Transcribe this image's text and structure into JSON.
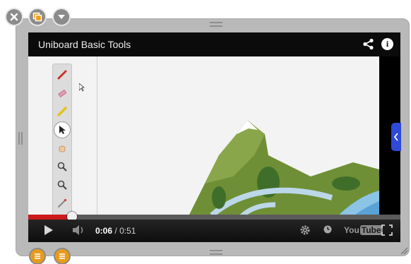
{
  "window": {
    "controls": [
      {
        "name": "close",
        "icon": "close-icon"
      },
      {
        "name": "duplicate",
        "icon": "duplicate-icon"
      },
      {
        "name": "menu",
        "icon": "chevron-down-icon"
      }
    ]
  },
  "video": {
    "title": "Uniboard Basic Tools",
    "current_time": "0:06",
    "separator": "/",
    "duration": "0:51",
    "progress_fraction": 0.118,
    "buffered_fraction": 1.0,
    "logo_text_1": "You",
    "logo_text_2": "Tube"
  },
  "toolbar": {
    "tools": [
      "pen-icon",
      "eraser-icon",
      "highlighter-icon",
      "pointer-icon",
      "hand-icon",
      "zoom-in-icon",
      "zoom-out-icon",
      "laser-pointer-icon",
      "line-icon"
    ]
  },
  "colors": {
    "frame": "#b9b9b9",
    "accent_red": "#cc1a1a",
    "side_tab_blue": "#2f49d8",
    "bottom_button_orange": "#e89b1a"
  }
}
